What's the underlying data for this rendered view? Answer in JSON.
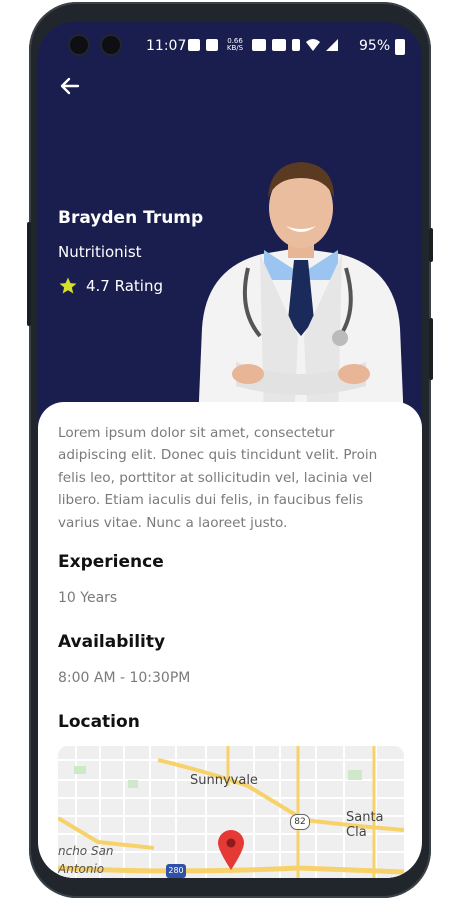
{
  "status_bar": {
    "time": "11:07",
    "network_speed": "0.66 KB/S",
    "battery": "95%",
    "icons": [
      "image-icon",
      "sigma-icon",
      "volte-icon",
      "wifi-call-icon",
      "vibrate-icon",
      "wifi-icon",
      "signal-icon",
      "battery-icon"
    ]
  },
  "header": {
    "back_icon": "arrow-left-icon"
  },
  "profile": {
    "name": "Brayden Trump",
    "role": "Nutritionist",
    "rating": "4.7 Rating",
    "rating_icon": "star-icon"
  },
  "details": {
    "bio": "Lorem ipsum dolor sit amet, consectetur adipiscing elit. Donec quis tincidunt velit. Proin felis leo, porttitor at sollicitudin vel, lacinia vel libero. Etiam iaculis dui felis, in faucibus felis varius vitae. Nunc a laoreet justo.",
    "experience_title": "Experience",
    "experience_value": "10 Years",
    "availability_title": "Availability",
    "availability_value": "8:00 AM - 10:30PM",
    "location_title": "Location"
  },
  "map": {
    "city_label": "Sunnyvale",
    "city_label_2": "Santa Cla",
    "city_label_3": "ncho San",
    "city_label_4": "Antonio",
    "highway_82": "82",
    "highway_280": "280",
    "pin_icon": "map-pin-icon"
  },
  "colors": {
    "hero_bg": "#1a1e4f",
    "card_bg": "#ffffff",
    "star": "#d4e02a",
    "pin": "#e53935",
    "road_major": "#f7d26a"
  }
}
